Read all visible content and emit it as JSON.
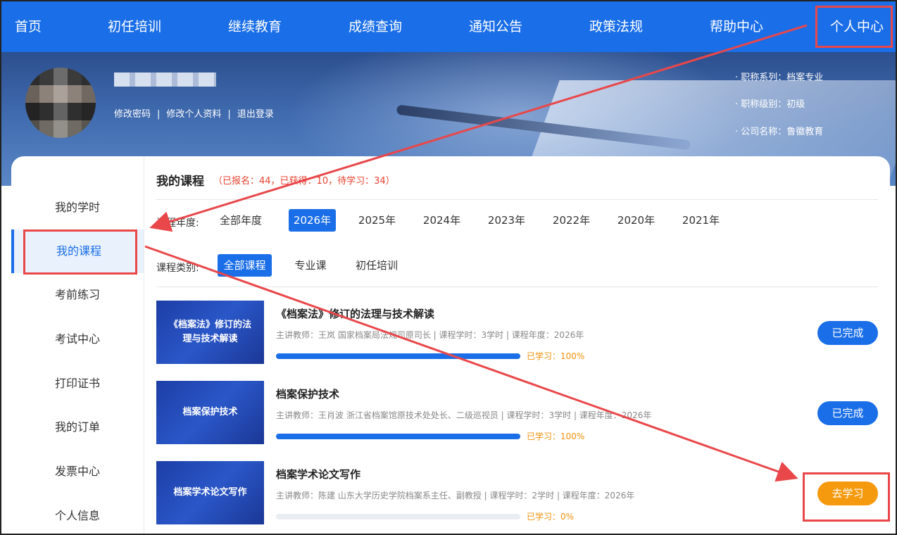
{
  "nav": {
    "items": [
      "首页",
      "初任培训",
      "继续教育",
      "成绩查询",
      "通知公告",
      "政策法规",
      "帮助中心",
      "个人中心"
    ]
  },
  "user": {
    "links": [
      "修改密码",
      "修改个人资料",
      "退出登录"
    ],
    "separator": "|",
    "info": [
      "· 职称系列：档案专业",
      "· 职称级别：初级",
      "· 公司名称：鲁徽教育"
    ]
  },
  "sidebar": {
    "items": [
      "我的学时",
      "我的课程",
      "考前练习",
      "考试中心",
      "打印证书",
      "我的订单",
      "发票中心",
      "个人信息"
    ],
    "active_index": 1
  },
  "main": {
    "title": "我的课程",
    "stats": "（已报名：44，已获得：10，待学习：34）",
    "year_filter": {
      "label": "课程年度:",
      "options": [
        "全部年度",
        "2026年",
        "2025年",
        "2024年",
        "2023年",
        "2022年",
        "2020年",
        "2021年"
      ],
      "active_index": 1
    },
    "type_filter": {
      "label": "课程类别:",
      "options": [
        "全部课程",
        "专业课",
        "初任培训"
      ],
      "active_index": 0
    },
    "courses": [
      {
        "thumb_text": "《档案法》修订的法理与技术解读",
        "title": "《档案法》修订的法理与技术解读",
        "meta": "主讲教师：王岚 国家档案局法规司原司长 | 课程学时：3学时 | 课程年度：2026年",
        "progress": 100,
        "progress_text": "已学习：100%",
        "button": "已完成",
        "status": "done"
      },
      {
        "thumb_text": "档案保护技术",
        "title": "档案保护技术",
        "meta": "主讲教师：王肖波 浙江省档案馆原技术处处长、二级巡视员 | 课程学时：3学时 | 课程年度：2026年",
        "progress": 100,
        "progress_text": "已学习：100%",
        "button": "已完成",
        "status": "done"
      },
      {
        "thumb_text": "档案学术论文写作",
        "title": "档案学术论文写作",
        "meta": "主讲教师：陈建 山东大学历史学院档案系主任、副教授 | 课程学时：2学时 | 课程年度：2026年",
        "progress": 0,
        "progress_text": "已学习：0%",
        "button": "去学习",
        "status": "go"
      }
    ]
  },
  "colors": {
    "brand": "#1a6ee8",
    "accent_orange": "#f59a0f",
    "annotation_red": "#e9474a"
  }
}
